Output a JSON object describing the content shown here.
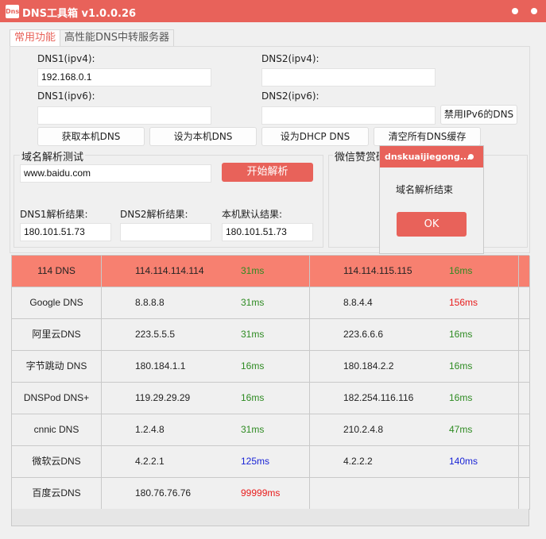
{
  "window": {
    "icon_text": "Dns",
    "title": "DNS工具箱 v1.0.0.26",
    "accent_color": "#e8625a"
  },
  "tabs": [
    {
      "label": "常用功能",
      "active": true
    },
    {
      "label": "高性能DNS中转服务器",
      "active": false
    }
  ],
  "dns": {
    "dns1_ipv4_label": "DNS1(ipv4):",
    "dns1_ipv4_value": "192.168.0.1",
    "dns2_ipv4_label": "DNS2(ipv4):",
    "dns2_ipv4_value": "",
    "dns1_ipv6_label": "DNS1(ipv6):",
    "dns1_ipv6_value": "",
    "dns2_ipv6_label": "DNS2(ipv6):",
    "dns2_ipv6_value": "",
    "disable_ipv6_button": "禁用IPv6的DNS"
  },
  "actions": {
    "get_local_dns": "获取本机DNS",
    "set_local_dns": "设为本机DNS",
    "set_dhcp_dns": "设为DHCP DNS",
    "clear_dns_cache": "清空所有DNS缓存"
  },
  "resolve_test": {
    "group_title": "域名解析测试",
    "domain_value": "www.baidu.com",
    "start_button": "开始解析",
    "dns1_result_label": "DNS1解析结果:",
    "dns1_result_value": "180.101.51.73",
    "dns2_result_label": "DNS2解析结果:",
    "dns2_result_value": "",
    "local_result_label": "本机默认结果:",
    "local_result_value": "180.101.51.73"
  },
  "reward": {
    "group_title": "微信赞赏码"
  },
  "popup": {
    "title": "dnskuaijiegong...",
    "message": "域名解析结束",
    "ok_button": "OK"
  },
  "latency_colors": {
    "fast": "#2e8b22",
    "medium": "#1a24d6",
    "slow": "#e81c1c"
  },
  "servers": [
    {
      "name": "114 DNS",
      "ip1": "114.114.114.114",
      "lat1": "31ms",
      "lat1_level": "fast",
      "ip2": "114.114.115.115",
      "lat2": "16ms",
      "lat2_level": "fast",
      "highlighted": true
    },
    {
      "name": "Google DNS",
      "ip1": "8.8.8.8",
      "lat1": "31ms",
      "lat1_level": "fast",
      "ip2": "8.8.4.4",
      "lat2": "156ms",
      "lat2_level": "slow",
      "highlighted": false
    },
    {
      "name": "阿里云DNS",
      "ip1": "223.5.5.5",
      "lat1": "31ms",
      "lat1_level": "fast",
      "ip2": "223.6.6.6",
      "lat2": "16ms",
      "lat2_level": "fast",
      "highlighted": false
    },
    {
      "name": "字节跳动 DNS",
      "ip1": "180.184.1.1",
      "lat1": "16ms",
      "lat1_level": "fast",
      "ip2": "180.184.2.2",
      "lat2": "16ms",
      "lat2_level": "fast",
      "highlighted": false
    },
    {
      "name": "DNSPod DNS+",
      "ip1": "119.29.29.29",
      "lat1": "16ms",
      "lat1_level": "fast",
      "ip2": "182.254.116.116",
      "lat2": "16ms",
      "lat2_level": "fast",
      "highlighted": false
    },
    {
      "name": "cnnic DNS",
      "ip1": "1.2.4.8",
      "lat1": "31ms",
      "lat1_level": "fast",
      "ip2": "210.2.4.8",
      "lat2": "47ms",
      "lat2_level": "fast",
      "highlighted": false
    },
    {
      "name": "微软云DNS",
      "ip1": "4.2.2.1",
      "lat1": "125ms",
      "lat1_level": "medium",
      "ip2": "4.2.2.2",
      "lat2": "140ms",
      "lat2_level": "medium",
      "highlighted": false
    },
    {
      "name": "百度云DNS",
      "ip1": "180.76.76.76",
      "lat1": "99999ms",
      "lat1_level": "slow",
      "ip2": "",
      "lat2": "",
      "lat2_level": "fast",
      "highlighted": false
    }
  ]
}
